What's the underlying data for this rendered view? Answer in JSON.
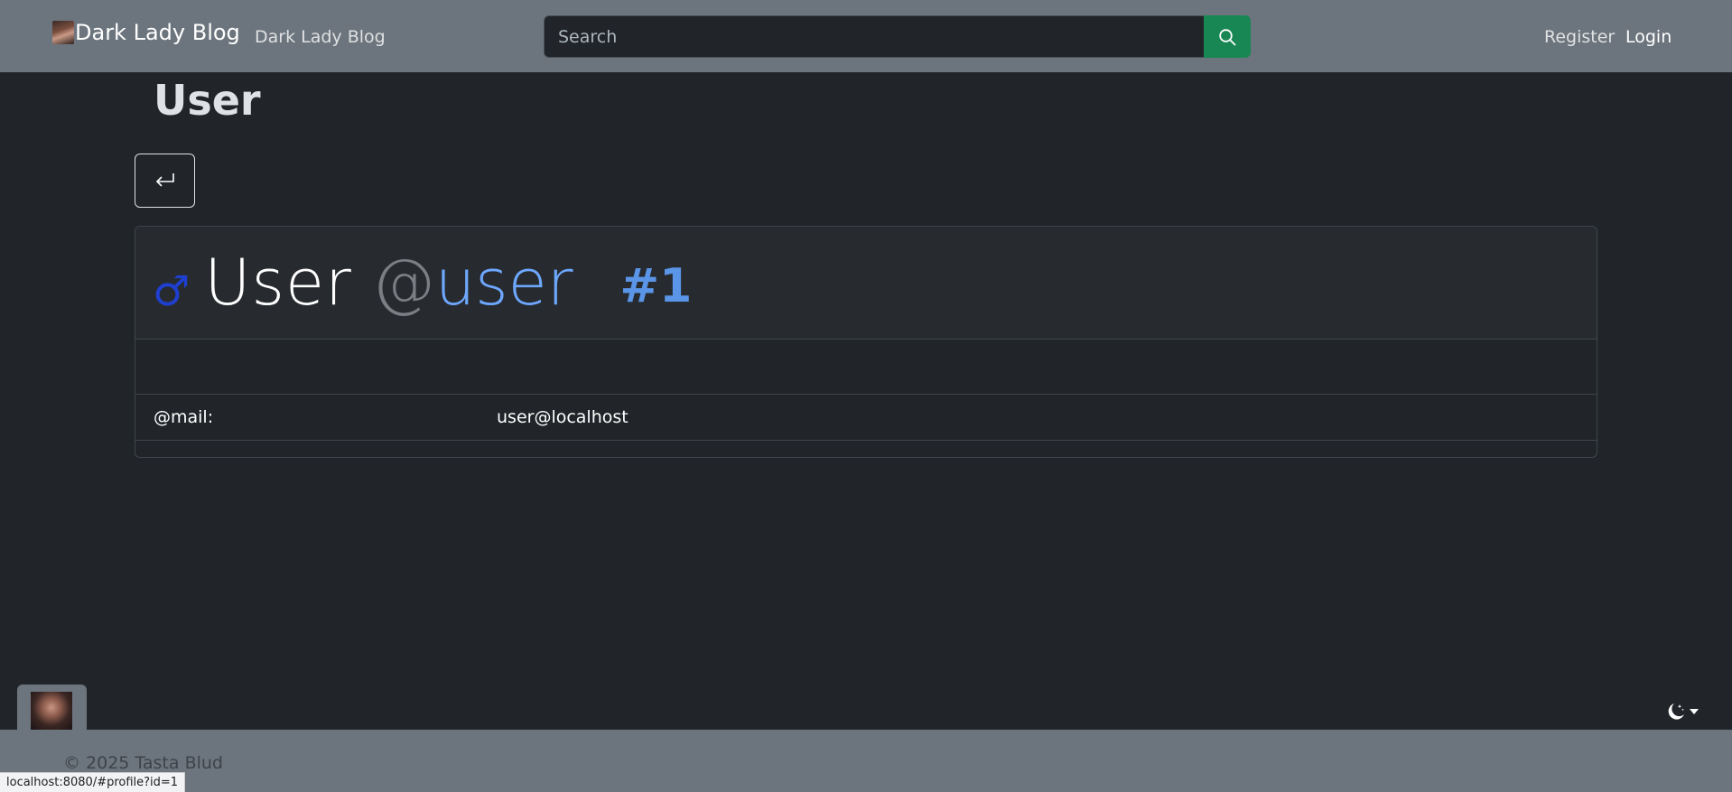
{
  "navbar": {
    "brand_label": "Dark Lady Blog",
    "brand_logo_icon": "portrait-image",
    "home_link": "Dark Lady Blog",
    "search": {
      "placeholder": "Search",
      "value": "",
      "button_icon": "search-icon",
      "button_color": "#198754"
    },
    "register_label": "Register",
    "login_label": "Login"
  },
  "main": {
    "page_title": "User",
    "back_button_icon": "return-arrow-icon",
    "profile": {
      "gender_symbol": "♂",
      "display_name": "User",
      "at_sign": "@",
      "username": "user",
      "id_label": "#1",
      "fields": [
        {
          "label": "@mail:",
          "value": "user@localhost"
        }
      ]
    }
  },
  "footer": {
    "copyright": "© 2025 Tasta Blud",
    "avatar_icon": "portrait-image",
    "theme_toggle_icon": "moon-stars-icon"
  },
  "status_bar": {
    "url": "localhost:8080/#profile?id=1"
  },
  "colors": {
    "navbar_bg": "#6c757d",
    "page_bg": "#212529",
    "accent_blue": "#6ea8fe",
    "search_button": "#198754"
  }
}
